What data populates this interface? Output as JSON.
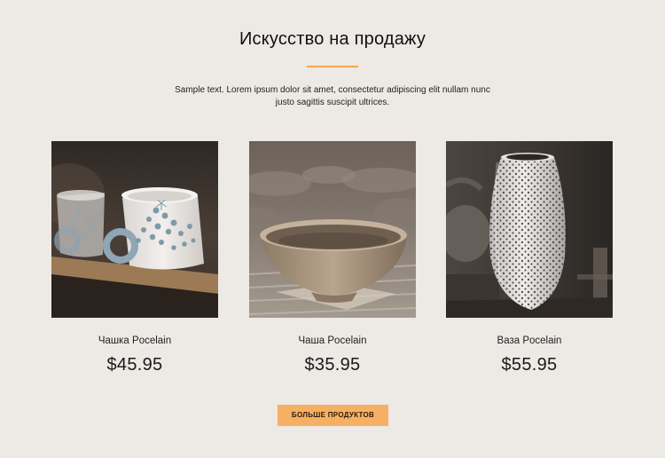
{
  "header": {
    "title": "Искусство на продажу",
    "subtitle": "Sample text. Lorem ipsum dolor sit amet, consectetur adipiscing elit nullam nunc justo sagittis suscipit ultrices."
  },
  "products": [
    {
      "name": "Чашка Pocelain",
      "price": "$45.95",
      "image": "cups-photo"
    },
    {
      "name": "Чаша Pocelain",
      "price": "$35.95",
      "image": "bowl-photo"
    },
    {
      "name": "Ваза Pocelain",
      "price": "$55.95",
      "image": "vase-photo"
    }
  ],
  "actions": {
    "more_label": "БОЛЬШЕ ПРОДУКТОВ"
  },
  "colors": {
    "background": "#ede9e5",
    "accent": "#f3a84a",
    "button": "#f6b063"
  }
}
